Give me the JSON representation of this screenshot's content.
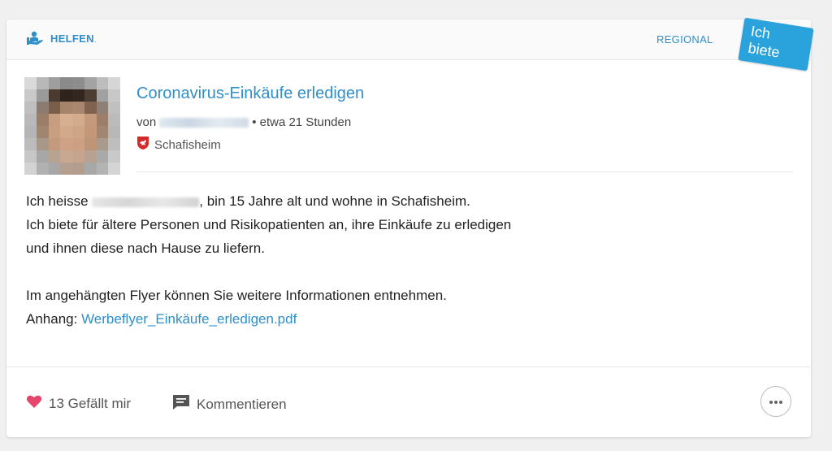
{
  "header": {
    "category": "HELFEN",
    "category_dot": ".",
    "region": "REGIONAL",
    "badge": "Ich biete"
  },
  "post": {
    "title": "Coronavirus-Einkäufe erledigen",
    "by_prefix": "von",
    "time": "• etwa 21 Stunden",
    "location": "Schafisheim",
    "line1_before": "Ich heisse ",
    "line1_after": ", bin 15 Jahre alt und wohne in Schafisheim.",
    "line2": "Ich biete für ältere Personen und Risikopatienten an, ihre Einkäufe zu erledigen",
    "line3": "und ihnen diese nach Hause zu liefern.",
    "line4": "Im angehängten Flyer können Sie weitere Informationen entnehmen.",
    "attachment_label": "Anhang: ",
    "attachment_file": "Werbeflyer_Einkäufe_erledigen.pdf"
  },
  "footer": {
    "likes": "13 Gefällt mir",
    "comment": "Kommentieren"
  },
  "colors": {
    "accent": "#2f8fc9",
    "badge": "#2aa3dd",
    "heart": "#e5466c"
  }
}
